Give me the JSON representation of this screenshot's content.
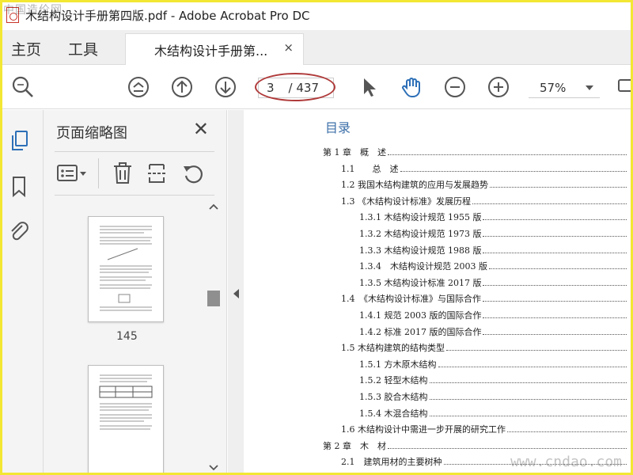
{
  "window": {
    "title": "木结构设计手册第四版.pdf - Adobe Acrobat Pro DC",
    "watermark_top": "中国造价网",
    "watermark_bottom": "www.cndao.com"
  },
  "tabs": {
    "home": "主页",
    "tools": "工具",
    "document": "木结构设计手册第...",
    "close": "×"
  },
  "toolbar": {
    "page_current": "3",
    "page_total": "/ 437",
    "zoom": "57%"
  },
  "thumbnails": {
    "title": "页面缩略图",
    "close": "✕",
    "page_label": "145"
  },
  "toc": {
    "title": "目录",
    "entries": [
      "第 1 章　概　述",
      "1.1　　总　述",
      "1.2 我国木结构建筑的应用与发展趋势",
      "1.3 《木结构设计标准》发展历程",
      "1.3.1 木结构设计规范 1955 版",
      "1.3.2 木结构设计规范 1973 版",
      "1.3.3 木结构设计规范 1988 版",
      "1.3.4　木结构设计规范 2003 版",
      "1.3.5 木结构设计标准 2017 版",
      "1.4　《木结构设计标准》与国际合作",
      "1.4.1 规范 2003 版的国际合作",
      "1.4.2 标准 2017 版的国际合作",
      "1.5 木结构建筑的结构类型",
      "1.5.1 方木原木结构",
      "1.5.2 轻型木结构",
      "1.5.3 胶合木结构",
      "1.5.4 木混合结构",
      "1.6 木结构设计中需进一步开展的研究工作",
      "第 2 章　木　材",
      "2.1　建筑用材的主要树种"
    ]
  },
  "colors": {
    "accent": "#3c6fa8",
    "highlight_oval": "#b03a3a",
    "frame": "#f3e733"
  }
}
